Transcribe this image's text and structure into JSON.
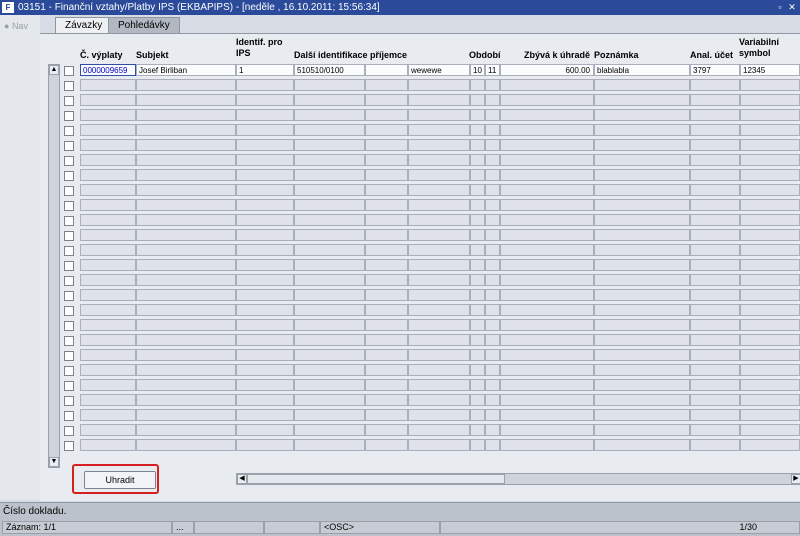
{
  "window": {
    "app_icon": "oracle-forms-icon",
    "title": "03151 - Finanční vztahy/Platby IPS (EKBAPIPS) - [neděle , 16.10.2011; 15:56:34]",
    "restore_glyph": "▫",
    "close_glyph": "✕"
  },
  "nav": {
    "label": "Nav"
  },
  "tabs": [
    {
      "label": "Závazky",
      "active": true
    },
    {
      "label": "Pohledávky",
      "active": false
    }
  ],
  "table": {
    "headers": {
      "c_vyplaty": "Č. výplaty",
      "subjekt": "Subjekt",
      "identif_line1": "Identif. pro",
      "identif_line2": "IPS",
      "dalsi": "Další identifikace příjemce",
      "obdobi": "Období",
      "zbyva": "Zbývá k úhradě",
      "poznamka": "Poznámka",
      "anal": "Anal. účet",
      "var_line1": "Variabilní",
      "var_line2": "symbol"
    },
    "first_row": {
      "c_vyplaty": "0000009659",
      "subjekt": "Josef Birliban",
      "identif": "1",
      "dalsi1": "510510/0100",
      "dalsi2": "",
      "dalsi3": "wewewe",
      "obdobi_mesic": "10",
      "obdobi_rok": "11",
      "zbyva": "600.00",
      "poznamka": "blablabla",
      "anal": "3797",
      "var": "12345"
    },
    "visible_rows": 26
  },
  "buttons": {
    "pay": "Uhradit"
  },
  "status": {
    "message": "Číslo dokladu.",
    "record": "Záznam: 1/1",
    "seg3": "...",
    "osc": "<OSC>",
    "page": "1/30"
  },
  "colors": {
    "titlebar": "#2b4a9a",
    "highlight": "#d62020",
    "active_cell_border": "#2e4ea6"
  }
}
